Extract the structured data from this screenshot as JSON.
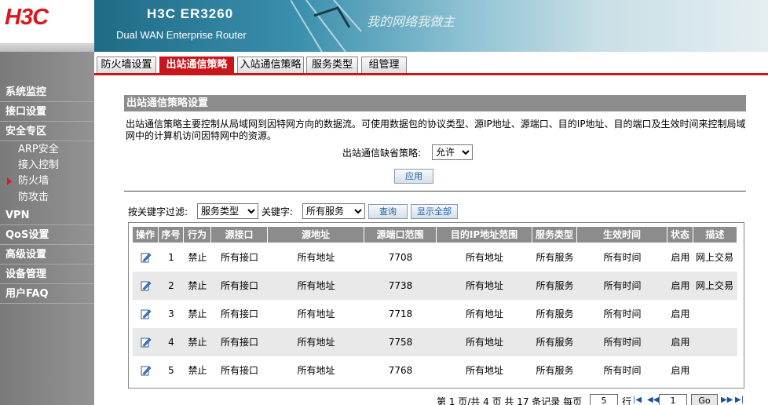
{
  "header": {
    "logo": "H3C",
    "product_title": "H3C ER3260",
    "product_subtitle": "Dual WAN Enterprise Router",
    "slogan": "我的网络我做主"
  },
  "tabs": [
    {
      "label": "防火墙设置",
      "active": false
    },
    {
      "label": "出站通信策略",
      "active": true
    },
    {
      "label": "入站通信策略",
      "active": false
    },
    {
      "label": "服务类型",
      "active": false
    },
    {
      "label": "组管理",
      "active": false
    }
  ],
  "sidebar": {
    "items": [
      {
        "label": "系统监控"
      },
      {
        "label": "接口设置"
      },
      {
        "label": "安全专区"
      },
      {
        "label": "ARP安全"
      },
      {
        "label": "接入控制"
      },
      {
        "label": "防火墙"
      },
      {
        "label": "防攻击"
      },
      {
        "label": "VPN"
      },
      {
        "label": "QoS设置"
      },
      {
        "label": "高级设置"
      },
      {
        "label": "设备管理"
      },
      {
        "label": "用户FAQ"
      }
    ]
  },
  "section": {
    "title": "出站通信策略设置",
    "description": "出站通信策略主要控制从局域网到因特网方向的数据流。可使用数据包的协议类型、源IP地址、源端口、目的IP地址、目的端口及生效时间来控制局域网中的计算机访问因特网中的资源。"
  },
  "default_policy": {
    "label": "出站通信缺省策略:",
    "value": "允许"
  },
  "apply_label": "应用",
  "filter": {
    "label": "按关键字过滤:",
    "field_value": "服务类型",
    "keyword_label": "关键字:",
    "keyword_value": "所有服务",
    "query_label": "查询",
    "show_all_label": "显示全部"
  },
  "table": {
    "headers": [
      "操作",
      "序号",
      "行为",
      "源接口",
      "源地址",
      "源端口范围",
      "目的IP地址范围",
      "服务类型",
      "生效时间",
      "状态",
      "描述"
    ],
    "rows": [
      {
        "index": "1",
        "action": "禁止",
        "src_if": "所有接口",
        "src_addr": "所有地址",
        "src_port": "7708",
        "dst_ip": "所有地址",
        "service": "所有服务",
        "time": "所有时间",
        "status": "启用",
        "desc": "网上交易"
      },
      {
        "index": "2",
        "action": "禁止",
        "src_if": "所有接口",
        "src_addr": "所有地址",
        "src_port": "7738",
        "dst_ip": "所有地址",
        "service": "所有服务",
        "time": "所有时间",
        "status": "启用",
        "desc": "网上交易"
      },
      {
        "index": "3",
        "action": "禁止",
        "src_if": "所有接口",
        "src_addr": "所有地址",
        "src_port": "7718",
        "dst_ip": "所有地址",
        "service": "所有服务",
        "time": "所有时间",
        "status": "启用",
        "desc": ""
      },
      {
        "index": "4",
        "action": "禁止",
        "src_if": "所有接口",
        "src_addr": "所有地址",
        "src_port": "7758",
        "dst_ip": "所有地址",
        "service": "所有服务",
        "time": "所有时间",
        "status": "启用",
        "desc": ""
      },
      {
        "index": "5",
        "action": "禁止",
        "src_if": "所有接口",
        "src_addr": "所有地址",
        "src_port": "7768",
        "dst_ip": "所有地址",
        "service": "所有服务",
        "time": "所有时间",
        "status": "启用",
        "desc": ""
      }
    ]
  },
  "pager": {
    "summary": "第 1 页/共 4 页 共 17 条记录 每页",
    "per_page": "5",
    "row_unit": "行",
    "page_input": "1",
    "go_label": "Go"
  },
  "colors": {
    "accent": "#c8161d",
    "sidebar": "#8a8a8a",
    "header_gray": "#8c8c8c"
  }
}
